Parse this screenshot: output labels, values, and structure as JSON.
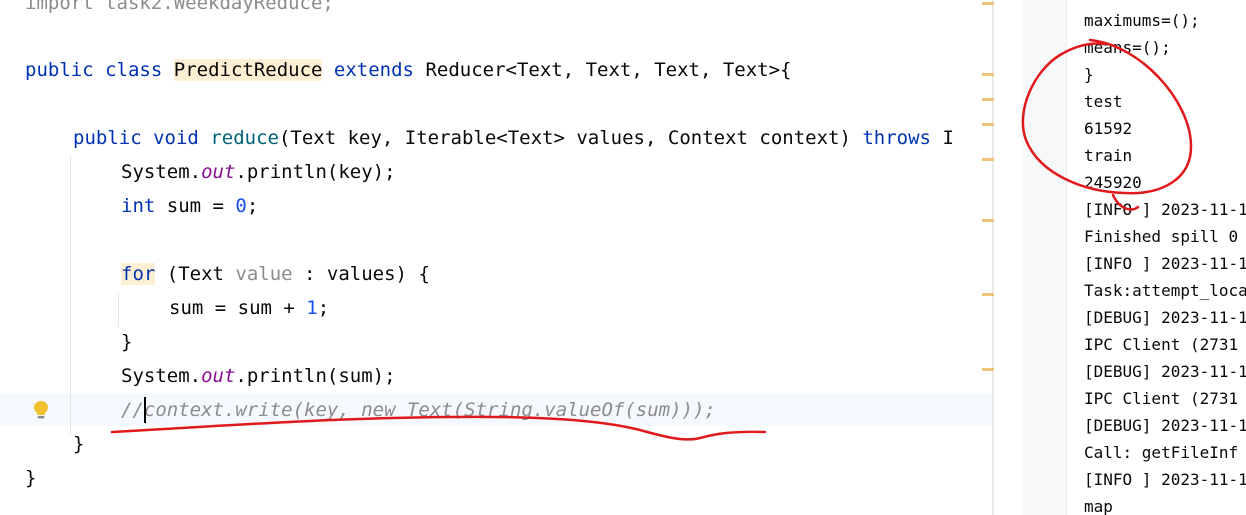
{
  "editor": {
    "lines": {
      "l0": "import task2.WeekdayReduce;",
      "l1_kw1": "public",
      "l1_kw2": "class",
      "l1_name": "PredictReduce",
      "l1_kw3": "extends",
      "l1_rest": "Reducer<Text, Text, Text, Text>{",
      "l2_kw1": "public",
      "l2_kw2": "void",
      "l2_fn": "reduce",
      "l2_rest": "(Text key, Iterable<Text> values, Context context)",
      "l2_kw3": "throws",
      "l2_cut": "I",
      "l3_a": "System.",
      "l3_out": "out",
      "l3_b": ".println(key);",
      "l4_kw": "int",
      "l4_a": " sum = ",
      "l4_num": "0",
      "l4_b": ";",
      "l5_kw": "for",
      "l5_a": " (Text ",
      "l5_var": "value",
      "l5_b": " : values) {",
      "l6_a": "sum = sum + ",
      "l6_num": "1",
      "l6_b": ";",
      "l7": "}",
      "l8_a": "System.",
      "l8_out": "out",
      "l8_b": ".println(sum);",
      "l9_a": "//",
      "l9_b": "context.write(key, new Text(String.valueOf(sum)));",
      "l10": "}",
      "l11": "}"
    }
  },
  "console": {
    "lines": [
      "maximums=();",
      "means=();",
      "}",
      "test",
      "61592",
      "train",
      "245920",
      "[INFO ] 2023-11-1",
      "Finished spill 0",
      "[INFO ] 2023-11-1",
      "Task:attempt_loca",
      "[DEBUG] 2023-11-1",
      "IPC Client (2731",
      "[DEBUG] 2023-11-1",
      "IPC Client (2731",
      "[DEBUG] 2023-11-1",
      "Call: getFileInf",
      "[INFO ] 2023-11-1",
      "map"
    ]
  },
  "colors": {
    "keyword": "#0033b3",
    "method": "#00627a",
    "static_field": "#871094",
    "number": "#1750eb",
    "comment": "#8c8c8c",
    "annotation": "#e0191c"
  }
}
